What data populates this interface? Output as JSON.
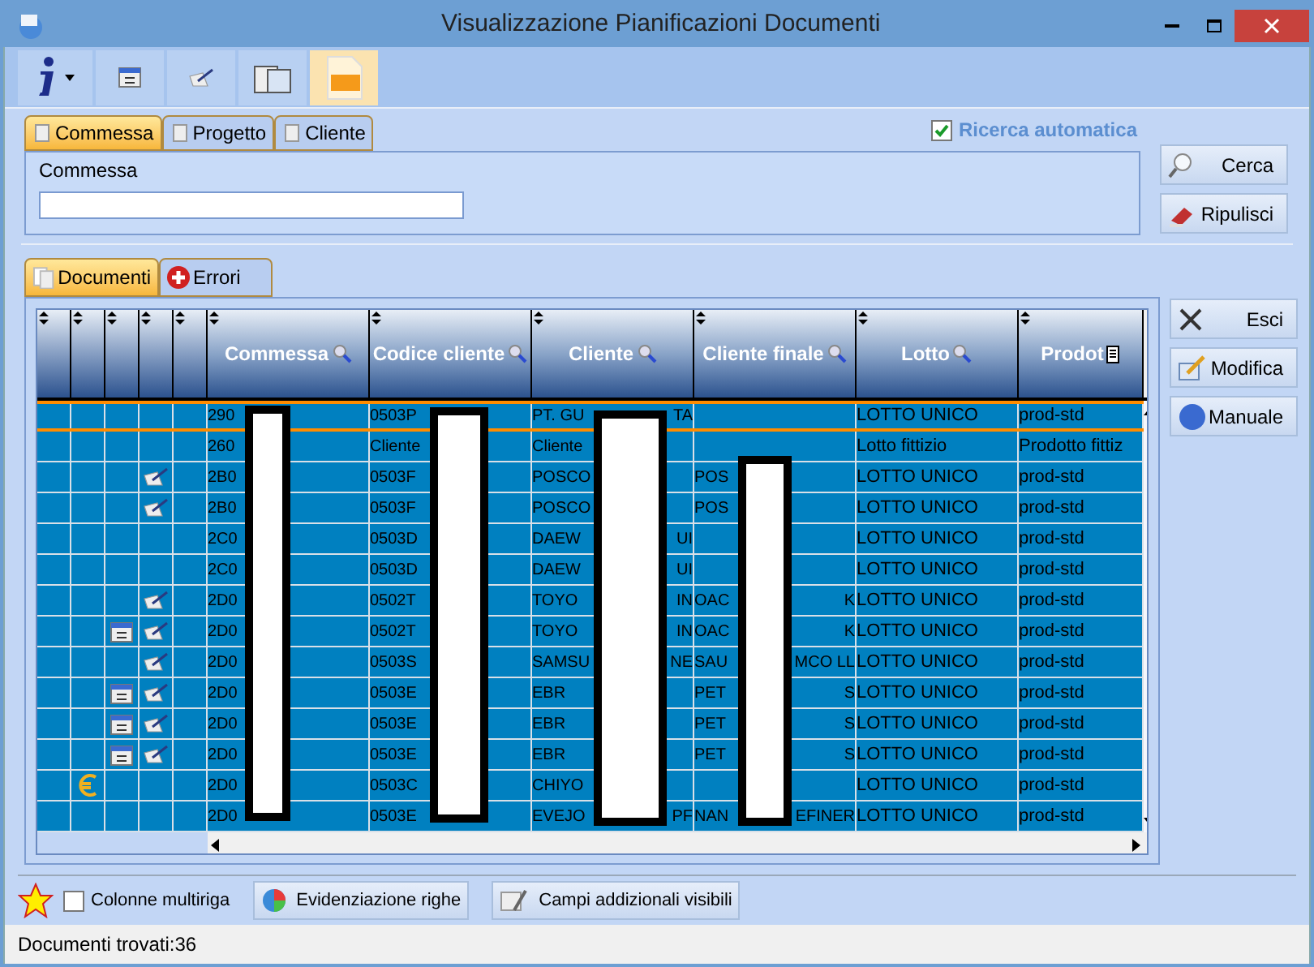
{
  "window": {
    "title": "Visualizzazione Pianificazioni Documenti"
  },
  "search_tabs": [
    {
      "label": "Commessa",
      "selected": true
    },
    {
      "label": "Progetto",
      "selected": false
    },
    {
      "label": "Cliente",
      "selected": false
    }
  ],
  "auto_search": {
    "label": "Ricerca automatica",
    "checked": true
  },
  "search_field": {
    "label": "Commessa"
  },
  "search_buttons": [
    "Cerca",
    "Ripulisci"
  ],
  "grid_tabs": [
    {
      "label": "Documenti",
      "selected": true
    },
    {
      "label": "Errori",
      "selected": false
    }
  ],
  "table": {
    "columns": [
      "Commessa",
      "Codice cliente",
      "Cliente",
      "Cliente finale",
      "Lotto",
      "Prodot"
    ],
    "rows": [
      {
        "selected": true,
        "euro": false,
        "calendar": false,
        "signed": false,
        "cells": [
          [
            "290"
          ],
          [
            "0503P"
          ],
          [
            "PT. GU",
            "TA"
          ],
          [
            ""
          ],
          [
            "LOTTO UNICO"
          ],
          [
            "prod-std"
          ]
        ]
      },
      {
        "selected": false,
        "euro": false,
        "calendar": false,
        "signed": false,
        "cells": [
          [
            "260"
          ],
          [
            "Cliente"
          ],
          [
            "Cliente"
          ],
          [
            ""
          ],
          [
            "Lotto fittizio"
          ],
          [
            "Prodotto fittiz"
          ]
        ]
      },
      {
        "selected": false,
        "euro": false,
        "calendar": false,
        "signed": true,
        "cells": [
          [
            "2B0"
          ],
          [
            "0503F"
          ],
          [
            "POSCO"
          ],
          [
            "POS"
          ],
          [
            "LOTTO UNICO"
          ],
          [
            "prod-std"
          ]
        ]
      },
      {
        "selected": false,
        "euro": false,
        "calendar": false,
        "signed": true,
        "cells": [
          [
            "2B0"
          ],
          [
            "0503F"
          ],
          [
            "POSCO"
          ],
          [
            "POS"
          ],
          [
            "LOTTO UNICO"
          ],
          [
            "prod-std"
          ]
        ]
      },
      {
        "selected": false,
        "euro": false,
        "calendar": false,
        "signed": false,
        "cells": [
          [
            "2C0"
          ],
          [
            "0503D"
          ],
          [
            "DAEW",
            "UI"
          ],
          [
            ""
          ],
          [
            "LOTTO UNICO"
          ],
          [
            "prod-std"
          ]
        ]
      },
      {
        "selected": false,
        "euro": false,
        "calendar": false,
        "signed": false,
        "cells": [
          [
            "2C0"
          ],
          [
            "0503D"
          ],
          [
            "DAEW",
            "UI"
          ],
          [
            ""
          ],
          [
            "LOTTO UNICO"
          ],
          [
            "prod-std"
          ]
        ]
      },
      {
        "selected": false,
        "euro": false,
        "calendar": false,
        "signed": true,
        "cells": [
          [
            "2D0"
          ],
          [
            "0502T"
          ],
          [
            "TOYO",
            "IN"
          ],
          [
            "OAC",
            "K"
          ],
          [
            "LOTTO UNICO"
          ],
          [
            "prod-std"
          ]
        ]
      },
      {
        "selected": false,
        "euro": false,
        "calendar": true,
        "signed": true,
        "cells": [
          [
            "2D0"
          ],
          [
            "0502T"
          ],
          [
            "TOYO",
            "IN"
          ],
          [
            "OAC",
            "K"
          ],
          [
            "LOTTO UNICO"
          ],
          [
            "prod-std"
          ]
        ]
      },
      {
        "selected": false,
        "euro": false,
        "calendar": false,
        "signed": true,
        "cells": [
          [
            "2D0"
          ],
          [
            "0503S"
          ],
          [
            "SAMSU",
            "NE"
          ],
          [
            "SAU",
            "MCO LL"
          ],
          [
            "LOTTO UNICO"
          ],
          [
            "prod-std"
          ]
        ]
      },
      {
        "selected": false,
        "euro": false,
        "calendar": true,
        "signed": true,
        "cells": [
          [
            "2D0"
          ],
          [
            "0503E"
          ],
          [
            "EBR"
          ],
          [
            "PET",
            "S"
          ],
          [
            "LOTTO UNICO"
          ],
          [
            "prod-std"
          ]
        ]
      },
      {
        "selected": false,
        "euro": false,
        "calendar": true,
        "signed": true,
        "cells": [
          [
            "2D0"
          ],
          [
            "0503E"
          ],
          [
            "EBR"
          ],
          [
            "PET",
            "S"
          ],
          [
            "LOTTO UNICO"
          ],
          [
            "prod-std"
          ]
        ]
      },
      {
        "selected": false,
        "euro": false,
        "calendar": true,
        "signed": true,
        "cells": [
          [
            "2D0"
          ],
          [
            "0503E"
          ],
          [
            "EBR"
          ],
          [
            "PET",
            "S"
          ],
          [
            "LOTTO UNICO"
          ],
          [
            "prod-std"
          ]
        ]
      },
      {
        "selected": false,
        "euro": true,
        "calendar": false,
        "signed": false,
        "cells": [
          [
            "2D0"
          ],
          [
            "0503C"
          ],
          [
            "CHIYO"
          ],
          [
            ""
          ],
          [
            "LOTTO UNICO"
          ],
          [
            "prod-std"
          ]
        ]
      },
      {
        "selected": false,
        "euro": false,
        "calendar": false,
        "signed": false,
        "cells": [
          [
            "2D0"
          ],
          [
            "0503E"
          ],
          [
            "EVEJO",
            "PF"
          ],
          [
            "NAN",
            "EFINER"
          ],
          [
            "LOTTO UNICO"
          ],
          [
            "prod-std"
          ]
        ]
      }
    ]
  },
  "side_buttons": [
    "Esci",
    "Modifica",
    "Manuale"
  ],
  "multiline_columns": {
    "label": "Colonne multiriga",
    "checked": false
  },
  "bottom_buttons": [
    "Evidenziazione righe",
    "Campi addizionali visibili"
  ],
  "status_bar": "Documenti trovati:36"
}
